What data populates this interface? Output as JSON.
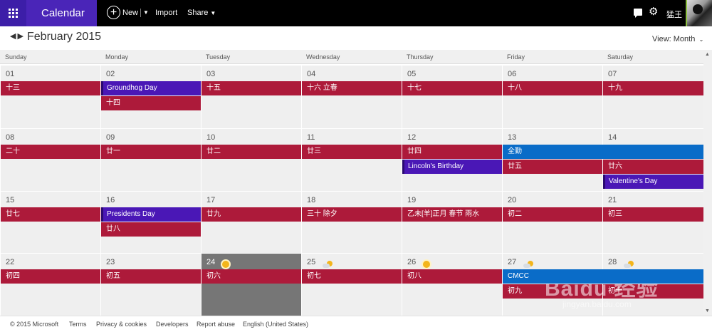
{
  "app": {
    "name": "Calendar",
    "new_label": "New",
    "import_label": "Import",
    "share_label": "Share",
    "username": "猛王"
  },
  "header": {
    "title": "February 2015",
    "view_label": "View: Month"
  },
  "weekdays": [
    "Sunday",
    "Monday",
    "Tuesday",
    "Wednesday",
    "Thursday",
    "Friday",
    "Saturday"
  ],
  "weeks": [
    {
      "days": [
        {
          "num": "01",
          "events": [
            {
              "label": "十三",
              "color": "red"
            }
          ]
        },
        {
          "num": "02",
          "events": [
            {
              "label": "Groundhog Day",
              "color": "purple"
            },
            {
              "label": "十四",
              "color": "red"
            }
          ]
        },
        {
          "num": "03",
          "events": [
            {
              "label": "十五",
              "color": "red"
            }
          ]
        },
        {
          "num": "04",
          "events": [
            {
              "label": "十六 立春",
              "color": "red"
            }
          ]
        },
        {
          "num": "05",
          "events": [
            {
              "label": "十七",
              "color": "red"
            }
          ]
        },
        {
          "num": "06",
          "events": [
            {
              "label": "十八",
              "color": "red"
            }
          ]
        },
        {
          "num": "07",
          "events": [
            {
              "label": "十九",
              "color": "red"
            }
          ]
        }
      ]
    },
    {
      "days": [
        {
          "num": "08",
          "events": [
            {
              "label": "二十",
              "color": "red"
            }
          ]
        },
        {
          "num": "09",
          "events": [
            {
              "label": "廿一",
              "color": "red"
            }
          ]
        },
        {
          "num": "10",
          "events": [
            {
              "label": "廿二",
              "color": "red"
            }
          ]
        },
        {
          "num": "11",
          "events": [
            {
              "label": "廿三",
              "color": "red"
            }
          ]
        },
        {
          "num": "12",
          "events": [
            {
              "label": "廿四",
              "color": "red"
            },
            {
              "label": "Lincoln's Birthday",
              "color": "purple"
            }
          ]
        },
        {
          "num": "13",
          "events": [
            {
              "label": "廿五",
              "color": "red"
            }
          ]
        },
        {
          "num": "14",
          "events": [
            {
              "label": "廿六",
              "color": "red"
            },
            {
              "label": "Valentine's Day",
              "color": "purple"
            }
          ]
        }
      ]
    },
    {
      "days": [
        {
          "num": "15",
          "events": [
            {
              "label": "廿七",
              "color": "red"
            }
          ]
        },
        {
          "num": "16",
          "events": [
            {
              "label": "Presidents Day",
              "color": "purple"
            },
            {
              "label": "廿八",
              "color": "red"
            }
          ]
        },
        {
          "num": "17",
          "events": [
            {
              "label": "廿九",
              "color": "red"
            }
          ]
        },
        {
          "num": "18",
          "events": [
            {
              "label": "三十 除夕",
              "color": "red"
            }
          ]
        },
        {
          "num": "19",
          "events": [
            {
              "label": "乙未[羊]正月 春节 雨水",
              "color": "red"
            }
          ]
        },
        {
          "num": "20",
          "events": [
            {
              "label": "初二",
              "color": "red"
            }
          ]
        },
        {
          "num": "21",
          "events": [
            {
              "label": "初三",
              "color": "red"
            }
          ]
        }
      ]
    },
    {
      "days": [
        {
          "num": "22",
          "events": [
            {
              "label": "初四",
              "color": "red"
            }
          ]
        },
        {
          "num": "23",
          "events": [
            {
              "label": "初五",
              "color": "red"
            }
          ]
        },
        {
          "num": "24",
          "weather": "sun-icon",
          "today": true,
          "events": [
            {
              "label": "初六",
              "color": "red"
            }
          ]
        },
        {
          "num": "25",
          "weather": "partly-cloudy-icon",
          "events": [
            {
              "label": "初七",
              "color": "red"
            }
          ]
        },
        {
          "num": "26",
          "weather": "sun-icon",
          "events": [
            {
              "label": "初八",
              "color": "red"
            }
          ]
        },
        {
          "num": "27",
          "weather": "partly-cloudy-icon",
          "events": [
            {
              "label": "初九",
              "color": "red"
            }
          ]
        },
        {
          "num": "28",
          "weather": "partly-cloudy-icon",
          "events": [
            {
              "label": "初十",
              "color": "red"
            }
          ]
        }
      ]
    }
  ],
  "spanning_events": [
    {
      "label": "全勤",
      "color": "blue",
      "week": 1
    },
    {
      "label": "CMCC",
      "color": "blue",
      "week": 3
    }
  ],
  "footer": {
    "links": [
      "© 2015 Microsoft",
      "Terms",
      "Privacy & cookies",
      "Developers",
      "Report abuse",
      "English (United States)"
    ]
  },
  "watermark": {
    "main": "Baidu 经验",
    "sub": "jingyan.baidu.com"
  },
  "colors": {
    "red": "#ad1a3a",
    "purple": "#4a17b6",
    "blue": "#0a6cc8",
    "topbar": "#000000",
    "accent": "#4a25b8"
  }
}
